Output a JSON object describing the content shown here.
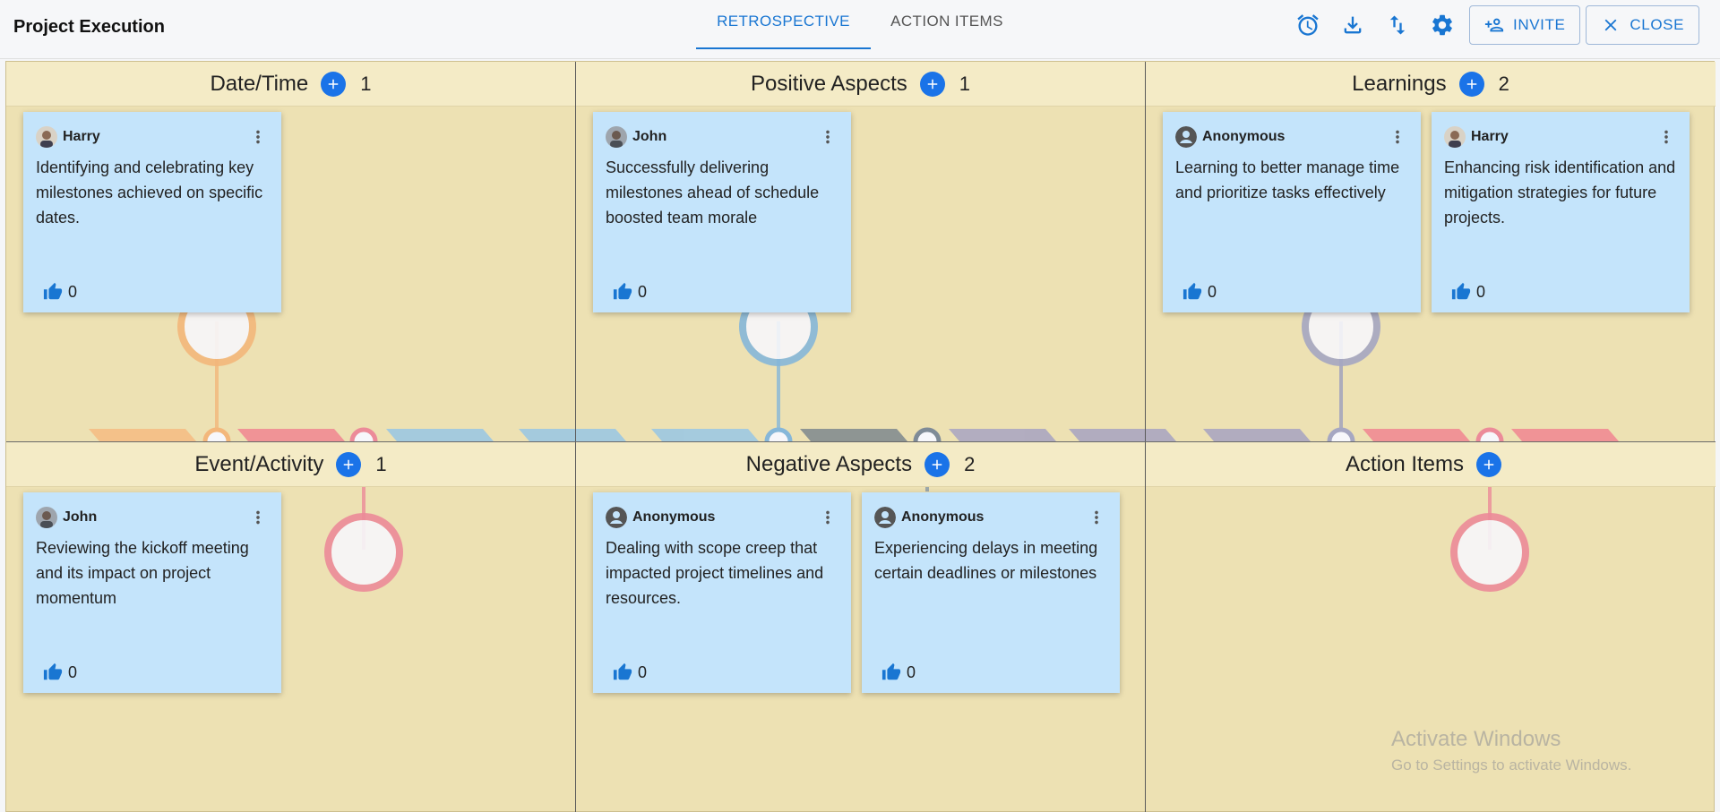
{
  "header": {
    "title": "Project Execution",
    "tabs": [
      "RETROSPECTIVE",
      "ACTION ITEMS"
    ],
    "invite_label": "INVITE",
    "close_label": "CLOSE"
  },
  "columns": [
    {
      "title": "Date/Time",
      "count": "1"
    },
    {
      "title": "Positive Aspects",
      "count": "1"
    },
    {
      "title": "Learnings",
      "count": "2"
    },
    {
      "title": "Event/Activity",
      "count": "1"
    },
    {
      "title": "Negative Aspects",
      "count": "2"
    },
    {
      "title": "Action Items",
      "count": ""
    }
  ],
  "cards": [
    {
      "author": "Harry",
      "text": "Identifying and celebrating key milestones achieved on specific dates.",
      "likes": "0"
    },
    {
      "author": "John",
      "text": "Successfully delivering milestones ahead of schedule boosted team morale",
      "likes": "0"
    },
    {
      "author": "Anonymous",
      "text": "Learning to better manage time and prioritize tasks effectively",
      "likes": "0"
    },
    {
      "author": "Harry",
      "text": "Enhancing risk identification and mitigation strategies for future projects.",
      "likes": "0"
    },
    {
      "author": "John",
      "text": "Reviewing the kickoff meeting and its impact on project momentum",
      "likes": "0"
    },
    {
      "author": "Anonymous",
      "text": "Dealing with scope creep that impacted project timelines and resources.",
      "likes": "0"
    },
    {
      "author": "Anonymous",
      "text": "Experiencing delays in meeting certain deadlines or milestones",
      "likes": "0"
    }
  ],
  "watermark": {
    "line1": "Activate Windows",
    "line2": "Go to Settings to activate Windows."
  },
  "colors": {
    "accent": "#1976d2",
    "card": "#c4e4fb",
    "board": "#ede1b3",
    "header_band": "#f4ebc6"
  },
  "icons": [
    "alarm-icon",
    "download-icon",
    "sort-icon",
    "gear-icon",
    "person-add-icon",
    "close-icon",
    "plus-icon",
    "more-vert-icon",
    "thumb-up-icon",
    "avatar-icon"
  ]
}
